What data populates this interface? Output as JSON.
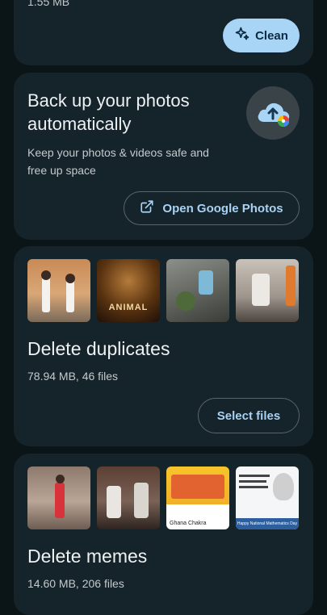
{
  "top_card": {
    "size_text": "1.55 MB",
    "clean_label": "Clean"
  },
  "backup_card": {
    "title": "Back up your photos automatically",
    "subtitle": "Keep your photos & videos safe and free up space",
    "button_label": "Open Google Photos"
  },
  "duplicates_card": {
    "title": "Delete duplicates",
    "meta": "78.94 MB, 46 files",
    "button_label": "Select files",
    "thumb_text": [
      "",
      "ANIMAL",
      "",
      ""
    ]
  },
  "memes_card": {
    "title": "Delete memes",
    "meta": "14.60 MB, 206 files",
    "thumb_text": [
      "",
      "",
      "Ghana Chakra",
      "Happy National Mathematics Day"
    ]
  },
  "colors": {
    "accent": "#a8d4f5",
    "card_bg": "#15232a",
    "page_bg": "#0b1518"
  }
}
